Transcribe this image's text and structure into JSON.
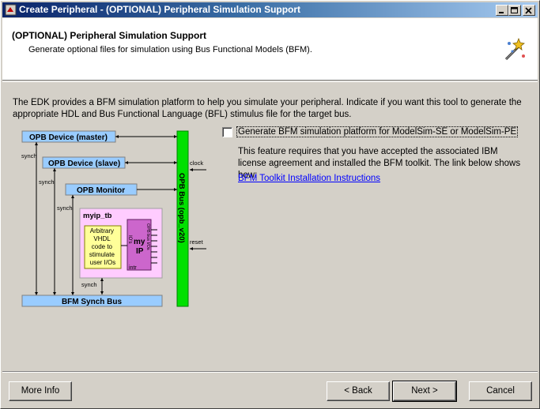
{
  "window": {
    "title": "Create Peripheral - (OPTIONAL) Peripheral Simulation Support"
  },
  "header": {
    "title": "(OPTIONAL) Peripheral Simulation Support",
    "subtitle": "Generate optional files for simulation using Bus Functional Models (BFM)."
  },
  "intro": "The EDK provides a BFM simulation platform to help you simulate your peripheral. Indicate if you want this tool to generate the appropriate HDL and Bus Functional Language (BFL) stimulus file for the target bus.",
  "diagram": {
    "opb_master": "OPB Device (master)",
    "opb_slave": "OPB Device (slave)",
    "opb_monitor": "OPB Monitor",
    "tb_label": "myip_tb",
    "vhdl_block": [
      "Arbitrary",
      "VHDL",
      "code to",
      "stimulate",
      "user I/Os"
    ],
    "ip_label1": "my",
    "ip_label2": "IP",
    "io_label": "IO's",
    "user_io_label": "OPB bus I/Os",
    "intr_label": "intr",
    "synch_bus": "BFM Synch Bus",
    "opb_bus": "OPB Bus (opb_v20)",
    "clock_label": "clock",
    "reset_label": "reset",
    "synch_label": "synch"
  },
  "option": {
    "checked": false,
    "label": "Generate BFM simulation platform for ModelSim-SE or ModelSim-PE"
  },
  "feature_text": "This feature requires that you have accepted the associated IBM license agreement and installed the BFM toolkit. The link below shows how:",
  "link_text": "BFM Toolkit Installation Instructions",
  "buttons": {
    "more_info": "More Info",
    "back": "< Back",
    "next": "Next >",
    "cancel": "Cancel"
  }
}
